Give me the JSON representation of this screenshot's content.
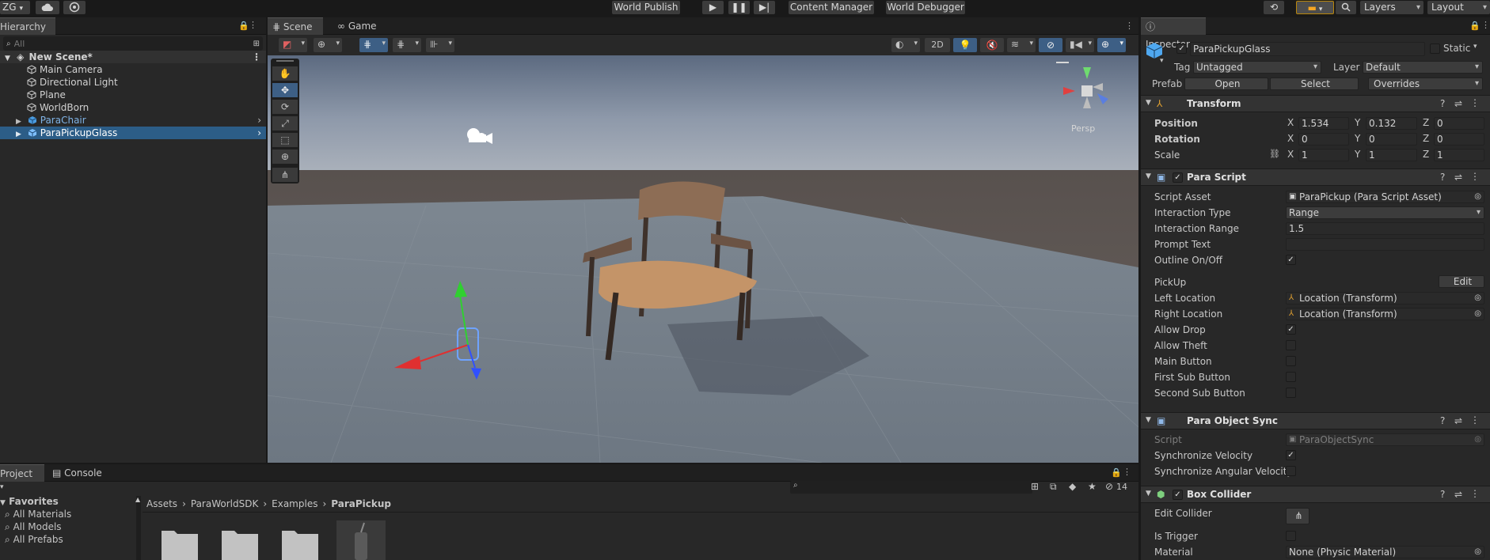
{
  "toolbar": {
    "account": "ZG",
    "world_publish": "World Publish",
    "content_manager": "Content Manager",
    "world_debugger": "World Debugger",
    "layers": "Layers",
    "layout": "Layout"
  },
  "hierarchy": {
    "tab": "Hierarchy",
    "search_placeholder": "All",
    "scene_name": "New Scene*",
    "items": [
      {
        "label": "Main Camera"
      },
      {
        "label": "Directional Light"
      },
      {
        "label": "Plane"
      },
      {
        "label": "WorldBorn"
      },
      {
        "label": "ParaChair"
      },
      {
        "label": "ParaPickupGlass"
      }
    ]
  },
  "scene": {
    "tabs": [
      "Scene",
      "Game"
    ],
    "btn_2d": "2D",
    "persp": "Persp",
    "colors": {
      "sky_top": "#5c6a80",
      "ground": "#6f7a86",
      "selection": "#2c5d87"
    }
  },
  "inspector": {
    "tab": "Inspector",
    "object_name": "ParaPickupGlass",
    "static_label": "Static",
    "tag_label": "Tag",
    "tag_value": "Untagged",
    "layer_label": "Layer",
    "layer_value": "Default",
    "prefab_label": "Prefab",
    "prefab_open": "Open",
    "prefab_select": "Select",
    "prefab_overrides": "Overrides",
    "transform": {
      "title": "Transform",
      "position_label": "Position",
      "rotation_label": "Rotation",
      "scale_label": "Scale",
      "x": "X",
      "y": "Y",
      "z": "Z",
      "position": [
        "1.534",
        "0.132",
        "0"
      ],
      "rotation": [
        "0",
        "0",
        "0"
      ],
      "scale": [
        "1",
        "1",
        "1"
      ]
    },
    "para_script": {
      "title": "Para Script",
      "script_asset_label": "Script Asset",
      "script_asset_value": "ParaPickup (Para Script Asset)",
      "interaction_type_label": "Interaction Type",
      "interaction_type_value": "Range",
      "interaction_range_label": "Interaction Range",
      "interaction_range_value": "1.5",
      "prompt_text_label": "Prompt Text",
      "outline_label": "Outline On/Off",
      "pickup_label": "PickUp",
      "edit_button": "Edit",
      "left_location_label": "Left Location",
      "left_location_value": "Location (Transform)",
      "right_location_label": "Right Location",
      "right_location_value": "Location (Transform)",
      "allow_drop_label": "Allow Drop",
      "allow_theft_label": "Allow Theft",
      "main_button_label": "Main Button",
      "first_sub_label": "First Sub Button",
      "second_sub_label": "Second Sub Button"
    },
    "object_sync": {
      "title": "Para Object Sync",
      "script_label": "Script",
      "script_value": "ParaObjectSync",
      "sync_velocity_label": "Synchronize Velocity",
      "sync_angular_label": "Synchronize Angular Velocity"
    },
    "box_collider": {
      "title": "Box Collider",
      "edit_collider_label": "Edit Collider",
      "is_trigger_label": "Is Trigger",
      "material_label": "Material",
      "material_value": "None (Physic Material)"
    }
  },
  "project": {
    "tabs": [
      "Project",
      "Console"
    ],
    "favorites_title": "Favorites",
    "favorites": [
      "All Materials",
      "All Models",
      "All Prefabs"
    ],
    "breadcrumb": [
      "Assets",
      "ParaWorldSDK",
      "Examples",
      "ParaPickup"
    ],
    "hidden_count": "14"
  }
}
